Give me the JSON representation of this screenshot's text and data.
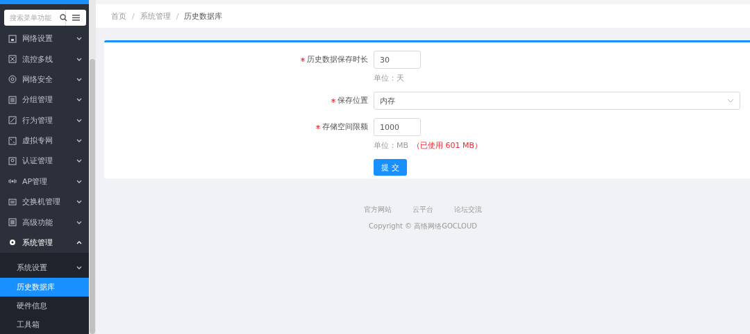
{
  "sidebar": {
    "search": {
      "placeholder": "搜索菜单功能"
    },
    "items": [
      {
        "label": "网络设置",
        "expanded": false
      },
      {
        "label": "流控多线",
        "expanded": false
      },
      {
        "label": "网络安全",
        "expanded": false
      },
      {
        "label": "分组管理",
        "expanded": false
      },
      {
        "label": "行为管理",
        "expanded": false
      },
      {
        "label": "虚拟专网",
        "expanded": false
      },
      {
        "label": "认证管理",
        "expanded": false
      },
      {
        "label": "AP管理",
        "expanded": false
      },
      {
        "label": "交换机管理",
        "expanded": false
      },
      {
        "label": "高级功能",
        "expanded": false
      },
      {
        "label": "系统管理",
        "expanded": true,
        "children": [
          {
            "label": "系统设置",
            "kind": "group",
            "selected": false
          },
          {
            "label": "历史数据库",
            "kind": "link",
            "selected": true
          },
          {
            "label": "硬件信息",
            "kind": "link",
            "selected": false
          },
          {
            "label": "工具箱",
            "kind": "link",
            "selected": false
          }
        ]
      }
    ]
  },
  "breadcrumb": {
    "items": [
      "首页",
      "系统管理",
      "历史数据库"
    ],
    "separators": [
      "/",
      "/"
    ]
  },
  "form": {
    "fields": [
      {
        "kind": "input",
        "required": true,
        "label": "历史数据保存时长",
        "value": "30",
        "hint": "单位：天"
      },
      {
        "kind": "select",
        "required": true,
        "label": "保存位置",
        "value": "内存"
      },
      {
        "kind": "input",
        "required": true,
        "label": "存储空间限额",
        "value": "1000",
        "hint": "单位：MB",
        "warning": "（已使用 601 MB）"
      }
    ],
    "submit": "提 交"
  },
  "footer": {
    "links": [
      "官方网站",
      "云平台",
      "论坛交流"
    ],
    "copyright": "Copyright © 高恪网络GOCLOUD"
  }
}
